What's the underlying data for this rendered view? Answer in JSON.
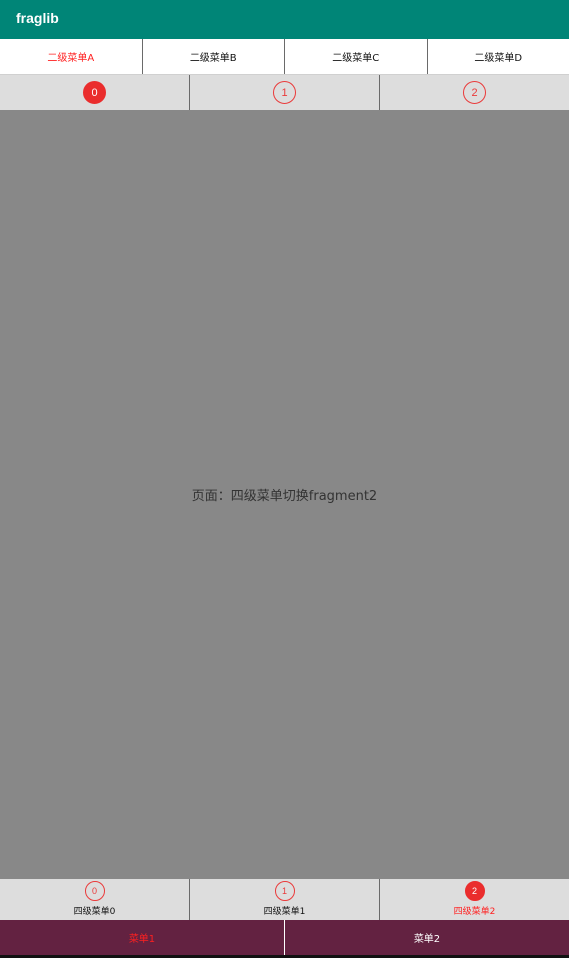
{
  "app_bar": {
    "title": "fraglib"
  },
  "level2_tabs": [
    {
      "label": "二级菜单A",
      "active": true
    },
    {
      "label": "二级菜单B",
      "active": false
    },
    {
      "label": "二级菜单C",
      "active": false
    },
    {
      "label": "二级菜单D",
      "active": false
    }
  ],
  "level3_tabs": [
    {
      "number": "0",
      "active": true
    },
    {
      "number": "1",
      "active": false
    },
    {
      "number": "2",
      "active": false
    }
  ],
  "content": {
    "text": "页面：四级菜单切换fragment2"
  },
  "level4_tabs": [
    {
      "number": "0",
      "label": "四级菜单0",
      "active": false
    },
    {
      "number": "1",
      "label": "四级菜单1",
      "active": false
    },
    {
      "number": "2",
      "label": "四级菜单2",
      "active": true
    }
  ],
  "bottom_nav": [
    {
      "label": "菜单1",
      "active": true
    },
    {
      "label": "菜单2",
      "active": false
    }
  ],
  "colors": {
    "app_bar": "#008577",
    "accent_red": "#ea2d2d",
    "content_bg": "#888888",
    "bottom_nav_bg": "#632241"
  }
}
